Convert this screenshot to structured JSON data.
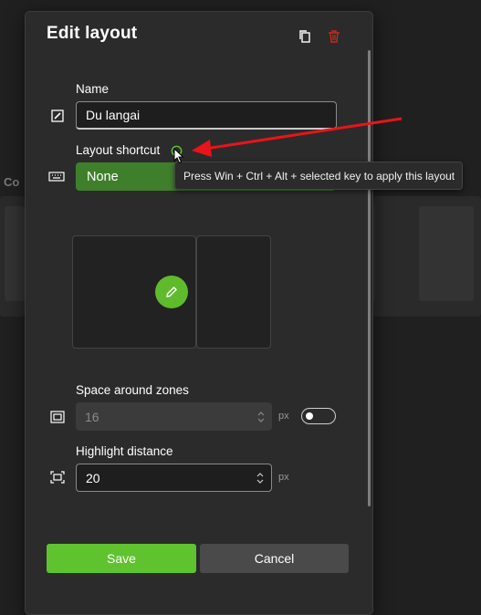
{
  "background": {
    "partial_label": "Co"
  },
  "dialog": {
    "title": "Edit layout",
    "name_section": {
      "label": "Name",
      "value": "Du langai"
    },
    "shortcut_section": {
      "label": "Layout shortcut",
      "button_value": "None",
      "tooltip": "Press Win + Ctrl + Alt + selected key to apply this layout"
    },
    "space_section": {
      "label": "Space around zones",
      "value": "16",
      "unit": "px",
      "toggle_on": false
    },
    "highlight_section": {
      "label": "Highlight distance",
      "value": "20",
      "unit": "px"
    },
    "buttons": {
      "save": "Save",
      "cancel": "Cancel"
    }
  },
  "colors": {
    "accent": "#5fc32f",
    "shortcut_button": "#3f7f2b",
    "delete_icon": "#c42b1c",
    "annotation_arrow": "#e8141b"
  },
  "icons": [
    "copy-icon",
    "delete-icon",
    "rename-icon",
    "keyboard-icon",
    "info-icon",
    "pencil-icon",
    "space-zones-icon",
    "highlight-distance-icon",
    "mouse-cursor-icon"
  ]
}
